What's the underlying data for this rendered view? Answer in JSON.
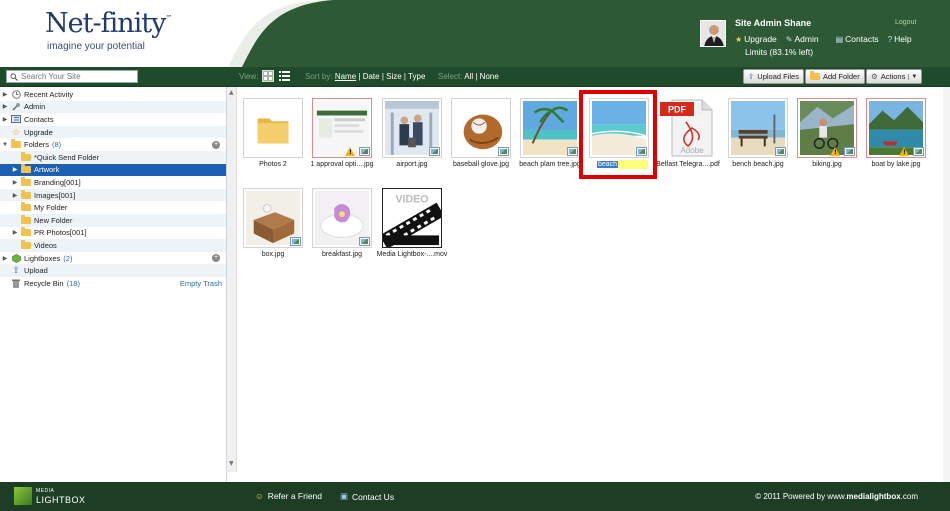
{
  "header": {
    "logo_text": "Net-finity",
    "logo_tm": "™",
    "tagline": "imagine your potential",
    "user_name": "Site Admin Shane",
    "logout": "Logout",
    "links": [
      {
        "icon": "star-icon",
        "label": "Upgrade"
      },
      {
        "icon": "wrench-icon",
        "label": "Admin"
      },
      {
        "icon": "contacts-book-icon",
        "label": "Contacts"
      },
      {
        "icon": "help-icon",
        "label": "Help"
      }
    ],
    "limits": "Limits (83.1% left)",
    "band_color": "#2d5a34"
  },
  "toolbar": {
    "search_placeholder": "Search Your Site",
    "view_label": "View:",
    "sort_label": "Sort by:",
    "sort_options": [
      "Name",
      "Date",
      "Size",
      "Type"
    ],
    "select_label": "Select:",
    "select_options": [
      "All",
      "None"
    ],
    "upload_button": "Upload Files",
    "add_folder_button": "Add Folder",
    "actions_button": "Actions"
  },
  "sidebar": {
    "items": [
      {
        "label": "Recent Activity",
        "expander": "▶",
        "icon": "clock-icon"
      },
      {
        "label": "Admin",
        "expander": "▶",
        "icon": "wrench-icon"
      },
      {
        "label": "Contacts",
        "expander": "▶",
        "icon": "contacts-book-icon"
      },
      {
        "label": "Upgrade",
        "expander": "",
        "icon": "star-icon"
      },
      {
        "label": "Folders",
        "count": "(8)",
        "expander": "▼",
        "icon": "folder-icon"
      },
      {
        "label": "*Quick Send Folder",
        "expander": "",
        "icon": "folder-icon"
      },
      {
        "label": "Artwork",
        "expander": "▶",
        "icon": "folder-icon"
      },
      {
        "label": "Branding[001]",
        "expander": "▶",
        "icon": "folder-icon"
      },
      {
        "label": "Images[001]",
        "expander": "▶",
        "icon": "folder-icon"
      },
      {
        "label": "My Folder",
        "expander": "",
        "icon": "folder-icon"
      },
      {
        "label": "New Folder",
        "expander": "",
        "icon": "folder-icon"
      },
      {
        "label": "PR Photos[001]",
        "expander": "▶",
        "icon": "folder-icon"
      },
      {
        "label": "Videos",
        "expander": "",
        "icon": "folder-icon"
      },
      {
        "label": "Lightboxes",
        "count": "(2)",
        "expander": "▶",
        "icon": "lightbox-cube-icon"
      },
      {
        "label": "Upload",
        "expander": "",
        "icon": "upload-arrow-icon"
      },
      {
        "label": "Recycle Bin",
        "count": "(18)",
        "expander": "",
        "icon": "trash-icon"
      }
    ],
    "empty_trash": "Empty Trash",
    "selected_label": "Artwork"
  },
  "files": [
    {
      "caption": "Photos 2",
      "kind": "folder"
    },
    {
      "caption": "1 approval opti....jpg",
      "kind": "screenshot",
      "warn": true
    },
    {
      "caption": "airport.jpg",
      "kind": "photo"
    },
    {
      "caption": "baseball glove.jpg",
      "kind": "photo"
    },
    {
      "caption": "beach plam tree.jpg",
      "kind": "photo"
    },
    {
      "caption": "beach",
      "kind": "photo",
      "editing": true
    },
    {
      "caption": "Belfast Telegra....pdf",
      "kind": "pdf",
      "pdf_label": "PDF",
      "pdf_brand": "Adobe"
    },
    {
      "caption": "bench beach.jpg",
      "kind": "photo"
    },
    {
      "caption": "biking.jpg",
      "kind": "photo",
      "warn": true
    },
    {
      "caption": "boat by lake.jpg",
      "kind": "photo",
      "warn": true
    },
    {
      "caption": "box.jpg",
      "kind": "photo"
    },
    {
      "caption": "breakfast.jpg",
      "kind": "photo"
    },
    {
      "caption": "Media Lightbox-....mov",
      "kind": "video",
      "video_label": "VIDEO"
    }
  ],
  "footer": {
    "brand_top": "MEDIA",
    "brand": "LIGHTBOX",
    "refer": "Refer a Friend",
    "contact": "Contact Us",
    "copyright_prefix": "© 2011 Powered by www.",
    "copyright_bold": "medialightbox",
    "copyright_suffix": ".com"
  }
}
